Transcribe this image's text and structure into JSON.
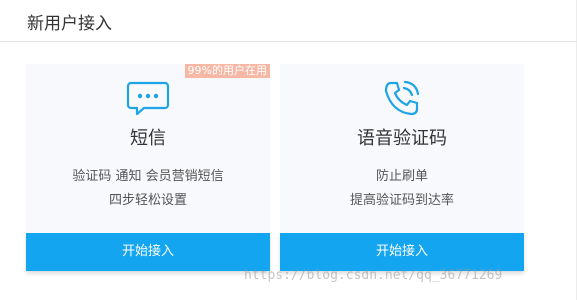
{
  "header": {
    "title": "新用户接入"
  },
  "cards": [
    {
      "icon": "chat-bubble-icon",
      "badge": "99%的用户在用",
      "title": "短信",
      "desc_line1": "验证码 通知 会员营销短信",
      "desc_line2": "四步轻松设置",
      "button_label": "开始接入"
    },
    {
      "icon": "phone-ringing-icon",
      "title": "语音验证码",
      "desc_line1": "防止刷单",
      "desc_line2": "提高验证码到达率",
      "button_label": "开始接入"
    }
  ],
  "watermark": "https://blog.csdn.net/qq_36771269",
  "colors": {
    "primary_button": "#14a5f0",
    "icon": "#1ea4e6",
    "badge": "#f6b8a5",
    "card_bg": "#f7f9fc"
  }
}
